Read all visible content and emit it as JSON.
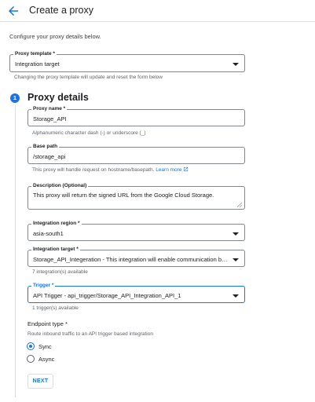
{
  "header": {
    "title": "Create a proxy",
    "back_icon": "arrow-left-icon"
  },
  "intro": "Configure your proxy details below.",
  "proxy_template": {
    "label": "Proxy template *",
    "value": "Integration target",
    "hint": "Changing the proxy template will update and reset the form below"
  },
  "step": {
    "number": "1",
    "title": "Proxy details"
  },
  "proxy_name": {
    "label": "Proxy name *",
    "value": "Storage_API",
    "hint": "Alphanumeric character dash (-) or underscore (_)"
  },
  "base_path": {
    "label": "Base path",
    "value": "/storage_api",
    "hint": "This proxy will handle request on hostname/basepath.",
    "link": "Learn more"
  },
  "description": {
    "label": "Description (Optional)",
    "value": "This proxy will return the signed URL from the Google Cloud Storage."
  },
  "integration_region": {
    "label": "Integration region *",
    "value": "asia-south1"
  },
  "integration_target": {
    "label": "Integration target *",
    "value": "Storage_API_Integeration - This integration will enable communication bet...",
    "hint": "7 integration(s) available"
  },
  "trigger": {
    "label": "Trigger *",
    "value": "API Trigger - api_trigger/Storage_API_Integration_API_1",
    "hint": "1 trigger(s) available"
  },
  "endpoint": {
    "label": "Endpoint type *",
    "hint": "Route inbound traffic to an API trigger based integration",
    "options": [
      "Sync",
      "Async"
    ],
    "selected": "Sync"
  },
  "next_label": "NEXT",
  "colors": {
    "accent": "#1a73e8",
    "border": "#80868b",
    "hint": "#5f6368"
  }
}
